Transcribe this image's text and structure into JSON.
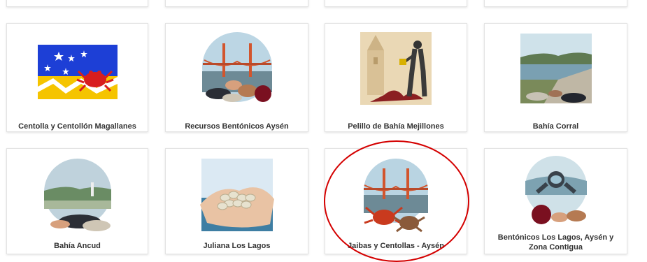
{
  "cards": [
    {
      "label": "Centolla y Centollón Magallanes",
      "icon": "magallanes-flag-crab-image"
    },
    {
      "label": "Recursos Bentónicos Aysén",
      "icon": "bridge-shellfish-image"
    },
    {
      "label": "Pelillo de Bahía Mejillones",
      "icon": "church-fisherman-seaweed-image"
    },
    {
      "label": "Bahía Corral",
      "icon": "bay-mussels-image"
    },
    {
      "label": "Bahía Ancud",
      "icon": "coast-shellfish-image"
    },
    {
      "label": "Juliana Los Lagos",
      "icon": "hands-clams-image"
    },
    {
      "label": "Jaibas y Centollas - Aysén",
      "icon": "bridge-crabs-image"
    },
    {
      "label": "Bentónicos Los Lagos, Aysén y Zona Contigua",
      "icon": "diver-urchin-image"
    }
  ],
  "colors": {
    "highlight": "#d40000",
    "card_border": "#e3e3e3",
    "label_text": "#333333"
  }
}
